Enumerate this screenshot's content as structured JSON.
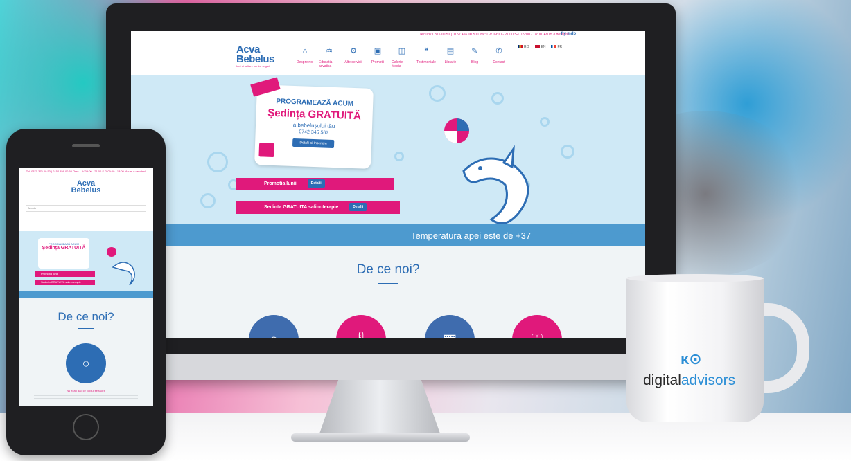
{
  "colors": {
    "brand_pink": "#e0197b",
    "brand_blue": "#2d6db4",
    "hero_bg": "#cfe9f6",
    "mug_accent": "#2d8fd6"
  },
  "site": {
    "topbar_text": "Tel: 0371 375 00 50 | 0152 456 00 50  Orar: L-V 09:00 - 21:00 S-D 09:00 - 18:00. Acum e deschis!",
    "social": "f y mdb",
    "logo_line1": "Acva",
    "logo_line2": "Bebelus",
    "logo_tagline": "Inot si saltare pentru sugari",
    "nav": [
      {
        "label": "Despre noi",
        "icon": "home-icon"
      },
      {
        "label": "Educatia acvatica",
        "icon": "swim-icon"
      },
      {
        "label": "Alte servicii",
        "icon": "service-icon"
      },
      {
        "label": "Promotii",
        "icon": "gift-icon"
      },
      {
        "label": "Galerie Media",
        "icon": "media-icon"
      },
      {
        "label": "Testimoniale",
        "icon": "quote-icon"
      },
      {
        "label": "Librarie",
        "icon": "book-icon"
      },
      {
        "label": "Blog",
        "icon": "pen-icon"
      },
      {
        "label": "Contact",
        "icon": "contact-icon"
      }
    ],
    "langs": [
      "RO",
      "EN",
      "FR"
    ],
    "hero": {
      "card_title": "PROGRAMEAZĂ ACUM",
      "card_headline": "Ședința GRATUITĂ",
      "card_sub": "a bebelușului tău",
      "card_phone": "0742 345 567",
      "card_button": "Detalii si Inscriere",
      "banner1": "Promotia lunii",
      "banner1_btn": "Detalii",
      "banner2": "Sedinta GRATUITA salinoterapie",
      "banner2_btn": "Detalii",
      "temperature": "Temperatura apei este de +37"
    },
    "section_title": "De ce noi?",
    "feature_icons": [
      "bubbles-icon",
      "thermometer-icon",
      "blocks-icon",
      "heart-icon"
    ]
  },
  "phone": {
    "menu": "Meniu",
    "section_title": "De ce noi?",
    "feature_text": "Nu ezati dad ce copiul se racira"
  },
  "mug": {
    "brand_plain": "digital",
    "brand_accent": "advisors"
  }
}
